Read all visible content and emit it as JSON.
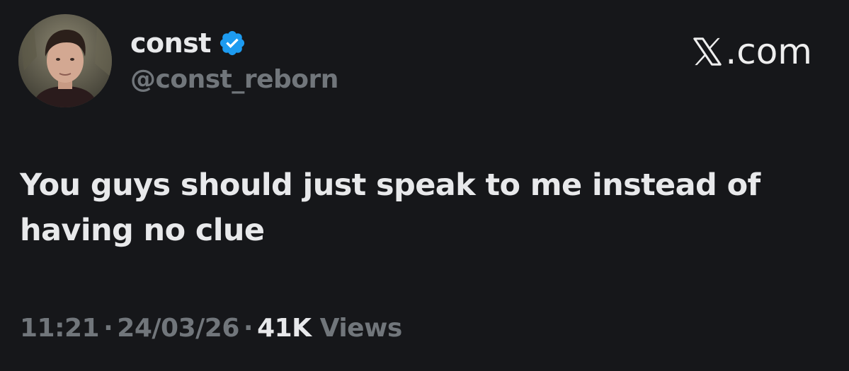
{
  "author": {
    "display_name": "const",
    "handle": "@const_reborn",
    "verified": true,
    "verified_icon": "verified-badge-icon",
    "verified_color": "#1d9bf0",
    "avatar": "profile-photo"
  },
  "brand": {
    "label": ".com",
    "icon": "x-logo-icon"
  },
  "tweet": {
    "text": "You guys should just speak to me instead of having no clue"
  },
  "meta": {
    "time": "11:21",
    "separator": "·",
    "date": "24/03/26",
    "views_count": "41K",
    "views_label": "Views"
  },
  "colors": {
    "background": "#16171a",
    "text_primary": "#e8e9eb",
    "text_secondary": "#71767b"
  }
}
